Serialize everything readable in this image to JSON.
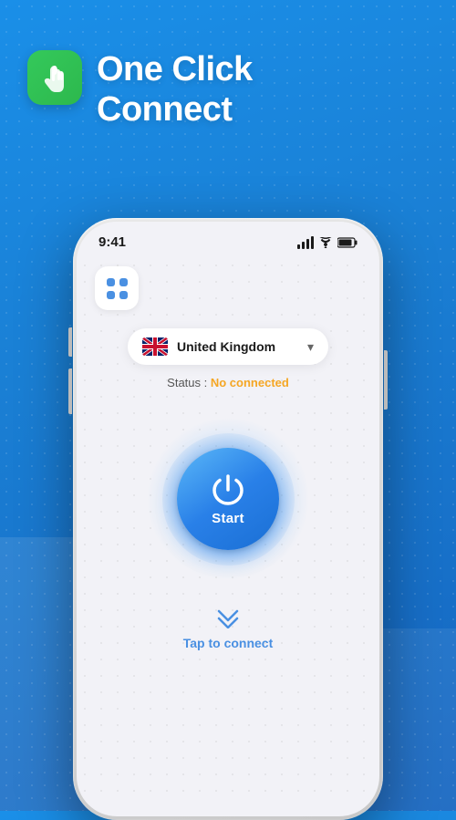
{
  "background": {
    "gradient_start": "#1a8fe8",
    "gradient_end": "#1565c0"
  },
  "header": {
    "title_line1": "One Click",
    "title_line2": "Connect",
    "icon_label": "touch-icon"
  },
  "phone": {
    "status_bar": {
      "time": "9:41",
      "signal_label": "signal-icon",
      "wifi_label": "wifi-icon",
      "battery_label": "battery-icon"
    },
    "menu_button_label": "menu-button",
    "country_selector": {
      "country_name": "United Kingdom",
      "flag_label": "uk-flag-icon",
      "chevron": "▾"
    },
    "status": {
      "label": "Status : ",
      "value": "No connected",
      "value_color": "#f5a623"
    },
    "power_button": {
      "label": "Start"
    },
    "tap_section": {
      "chevrons": "⌃⌃",
      "text": "Tap to connect"
    }
  }
}
